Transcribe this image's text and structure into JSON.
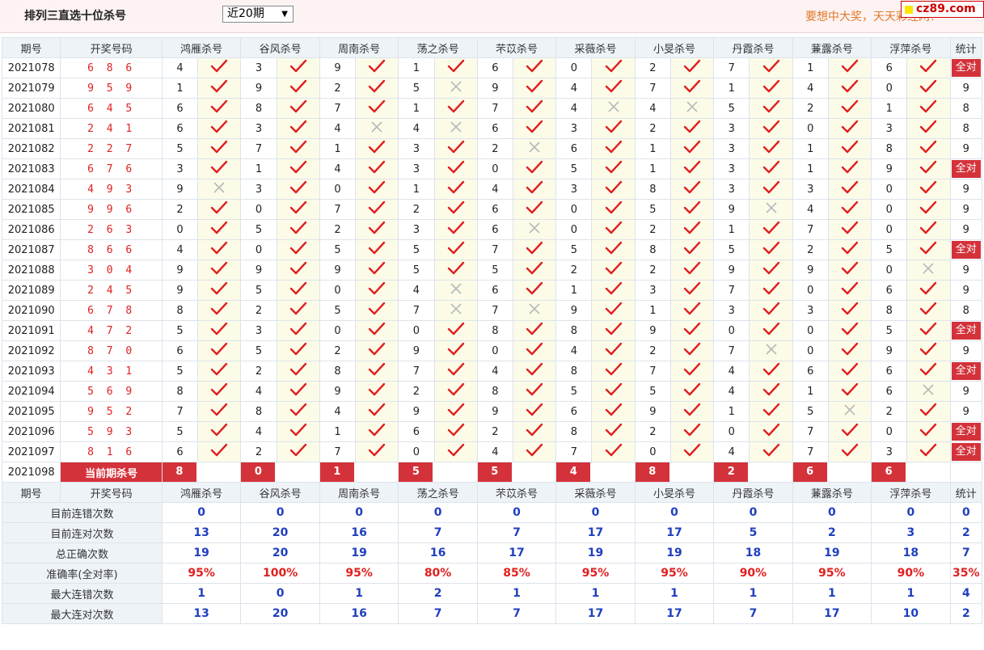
{
  "header": {
    "title": "排列三直选十位杀号",
    "period_select": "近20期",
    "slogan": "要想中大奖，天天彩经网！",
    "logo_text": "cz89.com"
  },
  "columns": {
    "period": "期号",
    "draw": "开奖号码",
    "experts": [
      "鸿雁杀号",
      "谷风杀号",
      "周南杀号",
      "荡之杀号",
      "芣苡杀号",
      "采薇杀号",
      "小旻杀号",
      "丹霞杀号",
      "蒹露杀号",
      "浮萍杀号"
    ],
    "stat": "统计"
  },
  "rows": [
    {
      "period": "2021078",
      "draw": "6 8 6",
      "kills": [
        4,
        3,
        9,
        1,
        6,
        0,
        2,
        7,
        1,
        6
      ],
      "ok": [
        1,
        1,
        1,
        1,
        1,
        1,
        1,
        1,
        1,
        1
      ],
      "stat": "全对"
    },
    {
      "period": "2021079",
      "draw": "9 5 9",
      "kills": [
        1,
        9,
        2,
        5,
        9,
        4,
        7,
        1,
        4,
        0
      ],
      "ok": [
        1,
        1,
        1,
        0,
        1,
        1,
        1,
        1,
        1,
        1
      ],
      "stat": "9"
    },
    {
      "period": "2021080",
      "draw": "6 4 5",
      "kills": [
        6,
        8,
        7,
        1,
        7,
        4,
        4,
        5,
        2,
        1
      ],
      "ok": [
        1,
        1,
        1,
        1,
        1,
        0,
        0,
        1,
        1,
        1
      ],
      "stat": "8"
    },
    {
      "period": "2021081",
      "draw": "2 4 1",
      "kills": [
        6,
        3,
        4,
        4,
        6,
        3,
        2,
        3,
        0,
        3
      ],
      "ok": [
        1,
        1,
        0,
        0,
        1,
        1,
        1,
        1,
        1,
        1
      ],
      "stat": "8"
    },
    {
      "period": "2021082",
      "draw": "2 2 7",
      "kills": [
        5,
        7,
        1,
        3,
        2,
        6,
        1,
        3,
        1,
        8
      ],
      "ok": [
        1,
        1,
        1,
        1,
        0,
        1,
        1,
        1,
        1,
        1
      ],
      "stat": "9"
    },
    {
      "period": "2021083",
      "draw": "6 7 6",
      "kills": [
        3,
        1,
        4,
        3,
        0,
        5,
        1,
        3,
        1,
        9
      ],
      "ok": [
        1,
        1,
        1,
        1,
        1,
        1,
        1,
        1,
        1,
        1
      ],
      "stat": "全对"
    },
    {
      "period": "2021084",
      "draw": "4 9 3",
      "kills": [
        9,
        3,
        0,
        1,
        4,
        3,
        8,
        3,
        3,
        0
      ],
      "ok": [
        0,
        1,
        1,
        1,
        1,
        1,
        1,
        1,
        1,
        1
      ],
      "stat": "9"
    },
    {
      "period": "2021085",
      "draw": "9 9 6",
      "kills": [
        2,
        0,
        7,
        2,
        6,
        0,
        5,
        9,
        4,
        0
      ],
      "ok": [
        1,
        1,
        1,
        1,
        1,
        1,
        1,
        0,
        1,
        1
      ],
      "stat": "9"
    },
    {
      "period": "2021086",
      "draw": "2 6 3",
      "kills": [
        0,
        5,
        2,
        3,
        6,
        0,
        2,
        1,
        7,
        0
      ],
      "ok": [
        1,
        1,
        1,
        1,
        0,
        1,
        1,
        1,
        1,
        1
      ],
      "stat": "9"
    },
    {
      "period": "2021087",
      "draw": "8 6 6",
      "kills": [
        4,
        0,
        5,
        5,
        7,
        5,
        8,
        5,
        2,
        5
      ],
      "ok": [
        1,
        1,
        1,
        1,
        1,
        1,
        1,
        1,
        1,
        1
      ],
      "stat": "全对"
    },
    {
      "period": "2021088",
      "draw": "3 0 4",
      "kills": [
        9,
        9,
        9,
        5,
        5,
        2,
        2,
        9,
        9,
        0
      ],
      "ok": [
        1,
        1,
        1,
        1,
        1,
        1,
        1,
        1,
        1,
        0
      ],
      "stat": "9"
    },
    {
      "period": "2021089",
      "draw": "2 4 5",
      "kills": [
        9,
        5,
        0,
        4,
        6,
        1,
        3,
        7,
        0,
        6
      ],
      "ok": [
        1,
        1,
        1,
        0,
        1,
        1,
        1,
        1,
        1,
        1
      ],
      "stat": "9"
    },
    {
      "period": "2021090",
      "draw": "6 7 8",
      "kills": [
        8,
        2,
        5,
        7,
        7,
        9,
        1,
        3,
        3,
        8
      ],
      "ok": [
        1,
        1,
        1,
        0,
        0,
        1,
        1,
        1,
        1,
        1
      ],
      "stat": "8"
    },
    {
      "period": "2021091",
      "draw": "4 7 2",
      "kills": [
        5,
        3,
        0,
        0,
        8,
        8,
        9,
        0,
        0,
        5
      ],
      "ok": [
        1,
        1,
        1,
        1,
        1,
        1,
        1,
        1,
        1,
        1
      ],
      "stat": "全对"
    },
    {
      "period": "2021092",
      "draw": "8 7 0",
      "kills": [
        6,
        5,
        2,
        9,
        0,
        4,
        2,
        7,
        0,
        9
      ],
      "ok": [
        1,
        1,
        1,
        1,
        1,
        1,
        1,
        0,
        1,
        1
      ],
      "stat": "9"
    },
    {
      "period": "2021093",
      "draw": "4 3 1",
      "kills": [
        5,
        2,
        8,
        7,
        4,
        8,
        7,
        4,
        6,
        6
      ],
      "ok": [
        1,
        1,
        1,
        1,
        1,
        1,
        1,
        1,
        1,
        1
      ],
      "stat": "全对"
    },
    {
      "period": "2021094",
      "draw": "5 6 9",
      "kills": [
        8,
        4,
        9,
        2,
        8,
        5,
        5,
        4,
        1,
        6
      ],
      "ok": [
        1,
        1,
        1,
        1,
        1,
        1,
        1,
        1,
        1,
        0
      ],
      "stat": "9"
    },
    {
      "period": "2021095",
      "draw": "9 5 2",
      "kills": [
        7,
        8,
        4,
        9,
        9,
        6,
        9,
        1,
        5,
        2
      ],
      "ok": [
        1,
        1,
        1,
        1,
        1,
        1,
        1,
        1,
        0,
        1
      ],
      "stat": "9"
    },
    {
      "period": "2021096",
      "draw": "5 9 3",
      "kills": [
        5,
        4,
        1,
        6,
        2,
        8,
        2,
        0,
        7,
        0
      ],
      "ok": [
        1,
        1,
        1,
        1,
        1,
        1,
        1,
        1,
        1,
        1
      ],
      "stat": "全对"
    },
    {
      "period": "2021097",
      "draw": "8 1 6",
      "kills": [
        6,
        2,
        7,
        0,
        4,
        7,
        0,
        4,
        7,
        3
      ],
      "ok": [
        1,
        1,
        1,
        1,
        1,
        1,
        1,
        1,
        1,
        1
      ],
      "stat": "全对"
    }
  ],
  "current": {
    "period": "2021098",
    "label": "当前期杀号",
    "kills": [
      8,
      0,
      1,
      5,
      5,
      4,
      8,
      2,
      6,
      6
    ]
  },
  "summary": [
    {
      "label": "目前连错次数",
      "values": [
        "0",
        "0",
        "0",
        "0",
        "0",
        "0",
        "0",
        "0",
        "0",
        "0"
      ],
      "stat": "0",
      "color": "blue"
    },
    {
      "label": "目前连对次数",
      "values": [
        "13",
        "20",
        "16",
        "7",
        "7",
        "17",
        "17",
        "5",
        "2",
        "3"
      ],
      "stat": "2",
      "color": "blue"
    },
    {
      "label": "总正确次数",
      "values": [
        "19",
        "20",
        "19",
        "16",
        "17",
        "19",
        "19",
        "18",
        "19",
        "18"
      ],
      "stat": "7",
      "color": "blue"
    },
    {
      "label": "准确率(全对率)",
      "values": [
        "95%",
        "100%",
        "95%",
        "80%",
        "85%",
        "95%",
        "95%",
        "90%",
        "95%",
        "90%"
      ],
      "stat": "35%",
      "color": "red"
    },
    {
      "label": "最大连错次数",
      "values": [
        "1",
        "0",
        "1",
        "2",
        "1",
        "1",
        "1",
        "1",
        "1",
        "1"
      ],
      "stat": "4",
      "color": "blue"
    },
    {
      "label": "最大连对次数",
      "values": [
        "13",
        "20",
        "16",
        "7",
        "7",
        "17",
        "17",
        "7",
        "17",
        "10"
      ],
      "stat": "2",
      "color": "blue"
    }
  ],
  "colors": {
    "accent_red": "#d4323a",
    "check_red": "#e02020",
    "cross_gray": "#b8b8b8",
    "blue": "#1f3fbf",
    "header_bg": "#eef3f8"
  }
}
